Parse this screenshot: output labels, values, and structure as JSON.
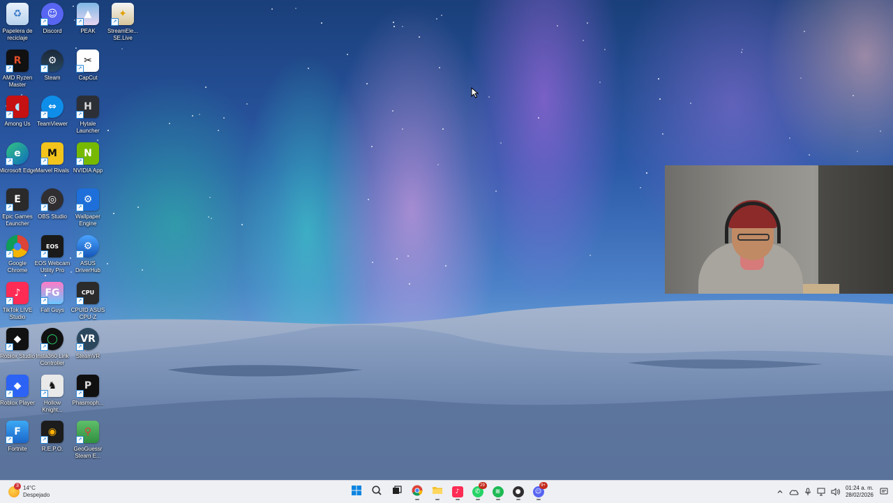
{
  "desktop": {
    "icons": [
      {
        "label": "Papelera de reciclaje",
        "icon": "recycle-bin-icon"
      },
      {
        "label": "Discord",
        "icon": "discord-icon"
      },
      {
        "label": "PEAK",
        "icon": "peak-game-icon"
      },
      {
        "label": "StreamEle... SE.Live",
        "icon": "streamelements-icon"
      },
      {
        "label": "AMD Ryzen Master",
        "icon": "amd-ryzen-icon"
      },
      {
        "label": "Steam",
        "icon": "steam-icon"
      },
      {
        "label": "CapCut",
        "icon": "capcut-icon"
      },
      {
        "label": "Among Us",
        "icon": "among-us-icon"
      },
      {
        "label": "TeamViewer",
        "icon": "teamviewer-icon"
      },
      {
        "label": "Hytale Launcher",
        "icon": "hytale-icon"
      },
      {
        "label": "Microsoft Edge",
        "icon": "edge-icon"
      },
      {
        "label": "Marvel Rivals",
        "icon": "marvel-rivals-icon"
      },
      {
        "label": "NVIDIA App",
        "icon": "nvidia-icon"
      },
      {
        "label": "Epic Games Launcher",
        "icon": "epic-games-icon"
      },
      {
        "label": "OBS Studio",
        "icon": "obs-icon"
      },
      {
        "label": "Wallpaper Engine",
        "icon": "wallpaper-engine-icon"
      },
      {
        "label": "Google Chrome",
        "icon": "chrome-icon"
      },
      {
        "label": "EOS Webcam Utility Pro",
        "icon": "eos-webcam-icon"
      },
      {
        "label": "ASUS DriverHub",
        "icon": "asus-driverhub-icon"
      },
      {
        "label": "TikTok LIVE Studio",
        "icon": "tiktok-icon"
      },
      {
        "label": "Fall Guys",
        "icon": "fall-guys-icon"
      },
      {
        "label": "CPUID ASUS CPU-Z",
        "icon": "cpu-z-icon"
      },
      {
        "label": "Roblox Studio",
        "icon": "roblox-studio-icon"
      },
      {
        "label": "Insta360 Link Controller",
        "icon": "insta360-icon"
      },
      {
        "label": "SteamVR",
        "icon": "steamvr-icon"
      },
      {
        "label": "Roblox Player",
        "icon": "roblox-player-icon"
      },
      {
        "label": "Hollow Knight...",
        "icon": "hollow-knight-icon"
      },
      {
        "label": "Phasmoph...",
        "icon": "phasmophobia-icon"
      },
      {
        "label": "Fortnite",
        "icon": "fortnite-icon"
      },
      {
        "label": "R.E.P.O.",
        "icon": "repo-game-icon"
      },
      {
        "label": "GeoGuessr Steam E...",
        "icon": "geoguessr-icon"
      }
    ]
  },
  "taskbar": {
    "weather": {
      "temp": "14°C",
      "condition": "Despejado",
      "badge": "3",
      "icon": "weather-sun-icon"
    },
    "apps": [
      {
        "name": "start",
        "icon": "windows-start-icon",
        "glyph": "",
        "color": "#0078d4"
      },
      {
        "name": "search",
        "icon": "search-icon",
        "glyph": "",
        "color": "#333333"
      },
      {
        "name": "task-view",
        "icon": "task-view-icon",
        "glyph": "",
        "color": "#333333"
      },
      {
        "name": "chrome",
        "icon": "chrome-icon",
        "glyph": "",
        "color": "#db4437"
      },
      {
        "name": "file-explorer",
        "icon": "folder-icon",
        "glyph": "",
        "color": "#f2c12e"
      },
      {
        "name": "tiktok",
        "icon": "tiktok-icon",
        "glyph": "♪",
        "color": "#fe2c55"
      },
      {
        "name": "whatsapp",
        "icon": "whatsapp-icon",
        "glyph": "✆",
        "color": "#25d366",
        "badge": "29"
      },
      {
        "name": "spotify",
        "icon": "spotify-icon",
        "glyph": "≋",
        "color": "#1db954"
      },
      {
        "name": "obs",
        "icon": "obs-recording-icon",
        "glyph": "●",
        "color": "#302e31"
      },
      {
        "name": "discord",
        "icon": "discord-icon",
        "glyph": "☺",
        "color": "#5865f2",
        "badge": "9+"
      }
    ],
    "tray": {
      "icons": [
        "chevron-up-icon",
        "onedrive-icon",
        "microphone-icon",
        "network-icon",
        "volume-icon"
      ],
      "time": "01:24 a. m.",
      "date": "28/02/2026",
      "notification_icon": "notification-icon"
    }
  },
  "colors": {
    "taskbar_bg": "#eef0f4",
    "accent": "#0078d4"
  }
}
